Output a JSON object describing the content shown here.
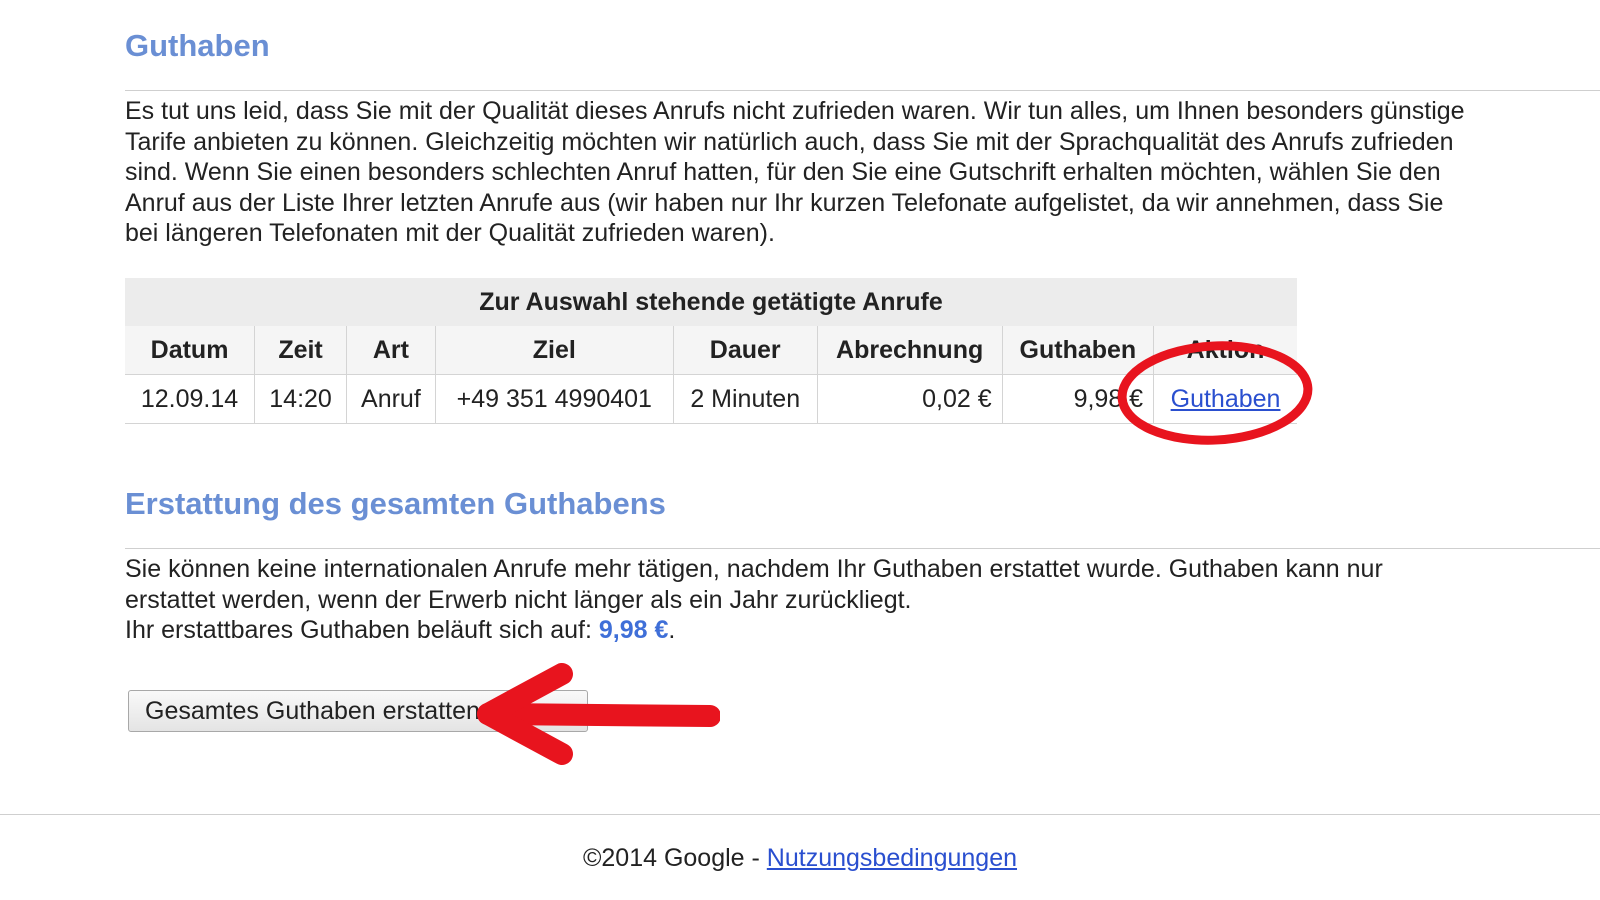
{
  "credit_section": {
    "heading": "Guthaben",
    "intro": "Es tut uns leid, dass Sie mit der Qualität dieses Anrufs nicht zufrieden waren. Wir tun alles, um Ihnen besonders günstige Tarife anbieten zu können. Gleichzeitig möchten wir natürlich auch, dass Sie mit der Sprachqualität des Anrufs zufrieden sind. Wenn Sie einen besonders schlechten Anruf hatten, für den Sie eine Gutschrift erhalten möchten, wählen Sie den Anruf aus der Liste Ihrer letzten Anrufe aus (wir haben nur Ihr kurzen Telefonate aufgelistet, da wir annehmen, dass Sie bei längeren Telefonaten mit der Qualität zufrieden waren).",
    "table": {
      "caption": "Zur Auswahl stehende getätigte Anrufe",
      "columns": [
        "Datum",
        "Zeit",
        "Art",
        "Ziel",
        "Dauer",
        "Abrechnung",
        "Guthaben",
        "Aktion"
      ],
      "rows": [
        {
          "datum": "12.09.14",
          "zeit": "14:20",
          "art": "Anruf",
          "ziel": "+49 351 4990401",
          "dauer": "2 Minuten",
          "abrechnung": "0,02 €",
          "guthaben": "9,98 €",
          "aktion": "Guthaben"
        }
      ]
    }
  },
  "refund_section": {
    "heading": "Erstattung des gesamten Guthabens",
    "text": "Sie können keine internationalen Anrufe mehr tätigen, nachdem Ihr Guthaben erstattet wurde. Guthaben kann nur erstattet werden, wenn der Erwerb nicht länger als ein Jahr zurückliegt.",
    "amount_prefix": "Ihr erstattbares Guthaben beläuft sich auf: ",
    "amount": "9,98 €",
    "amount_suffix": ".",
    "button_label": "Gesamtes Guthaben erstatten"
  },
  "footer": {
    "copyright": "©2014 Google - ",
    "terms_link": "Nutzungsbedingungen"
  },
  "annotations": {
    "color": "#e8141e"
  }
}
